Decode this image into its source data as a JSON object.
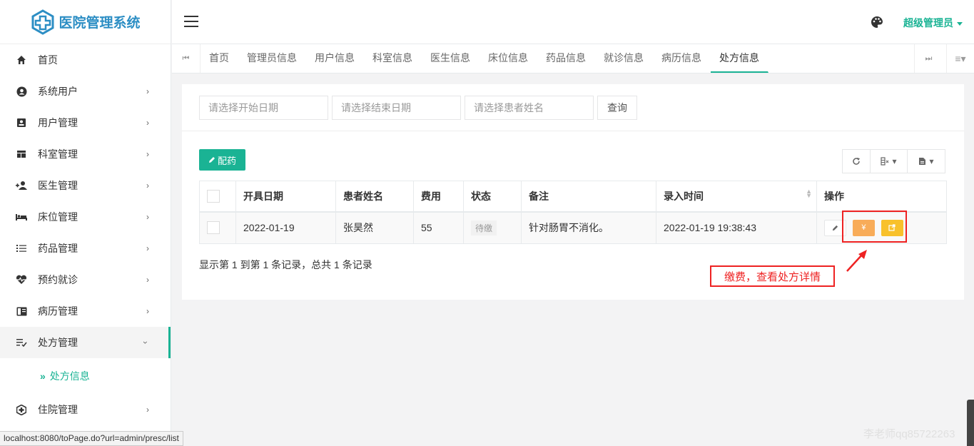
{
  "app": {
    "logo_text": "医院管理系统"
  },
  "sidebar": {
    "items": [
      {
        "label": "首页",
        "icon": "home-icon"
      },
      {
        "label": "系统用户",
        "icon": "user-circle-icon"
      },
      {
        "label": "用户管理",
        "icon": "id-card-icon"
      },
      {
        "label": "科室管理",
        "icon": "layout-icon"
      },
      {
        "label": "医生管理",
        "icon": "user-plus-icon"
      },
      {
        "label": "床位管理",
        "icon": "bed-icon"
      },
      {
        "label": "药品管理",
        "icon": "list-icon"
      },
      {
        "label": "预约就诊",
        "icon": "heartbeat-icon"
      },
      {
        "label": "病历管理",
        "icon": "book-icon"
      },
      {
        "label": "处方管理",
        "icon": "checklist-icon"
      },
      {
        "label": "住院管理",
        "icon": "hospital-icon"
      }
    ],
    "sub_item": "处方信息"
  },
  "header": {
    "user": "超级管理员"
  },
  "tabs": [
    "首页",
    "管理员信息",
    "用户信息",
    "科室信息",
    "医生信息",
    "床位信息",
    "药品信息",
    "就诊信息",
    "病历信息",
    "处方信息"
  ],
  "search": {
    "start_date_placeholder": "请选择开始日期",
    "end_date_placeholder": "请选择结束日期",
    "patient_placeholder": "请选择患者姓名",
    "query_label": "查询"
  },
  "actions": {
    "dispense_label": "配药"
  },
  "table": {
    "columns": [
      "开具日期",
      "患者姓名",
      "费用",
      "状态",
      "备注",
      "录入时间",
      "操作"
    ],
    "rows": [
      {
        "date": "2022-01-19",
        "patient": "张昊然",
        "fee": "55",
        "status": "待缴",
        "note": "针对肠胃不消化。",
        "entry_time": "2022-01-19 19:38:43"
      }
    ]
  },
  "pagination": {
    "summary": "显示第 1 到第 1 条记录，总共 1 条记录"
  },
  "annotation": {
    "text": "缴费，查看处方详情"
  },
  "status_url": "localhost:8080/toPage.do?url=admin/presc/list",
  "watermark": "李老师qq85722263",
  "colors": {
    "accent": "#1ab394",
    "pay": "#f8ac59",
    "view": "#f8c12b",
    "annotation": "#ee2222",
    "logo": "#2c8ec4"
  }
}
